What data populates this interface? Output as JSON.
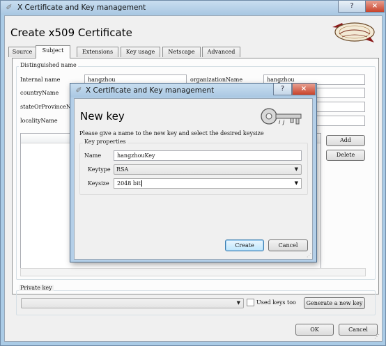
{
  "main_window": {
    "title": "X Certificate and Key management",
    "help_button": "?",
    "close_button": "×",
    "heading": "Create x509 Certificate",
    "tabs": [
      {
        "label": "Source"
      },
      {
        "label": "Subject"
      },
      {
        "label": "Extensions"
      },
      {
        "label": "Key usage"
      },
      {
        "label": "Netscape"
      },
      {
        "label": "Advanced"
      }
    ],
    "active_tab": "Subject",
    "distinguished_name": {
      "title": "Distinguished name",
      "internal_name_label": "Internal name",
      "internal_name_value": "hangzhou",
      "organization_name_label": "organizationName",
      "organization_name_value": "hangzhou",
      "country_name_label": "countryName",
      "state_label": "stateOrProvinceName",
      "locality_label": "localityName"
    },
    "add_button": "Add",
    "delete_button": "Delete",
    "private_key": {
      "title": "Private key",
      "used_keys_label": "Used keys too",
      "generate_button": "Generate a new key"
    },
    "ok_button": "OK",
    "cancel_button": "Cancel"
  },
  "dialog": {
    "title": "X Certificate and Key management",
    "help_button": "?",
    "close_button": "×",
    "heading": "New key",
    "instruction": "Please give a name to the new key and select the desired keysize",
    "properties_title": "Key properties",
    "name_label": "Name",
    "name_value": "hangzhouKey",
    "keytype_label": "Keytype",
    "keytype_value": "RSA",
    "keysize_label": "Keysize",
    "keysize_value": "2048 bit",
    "create_button": "Create",
    "cancel_button": "Cancel"
  }
}
